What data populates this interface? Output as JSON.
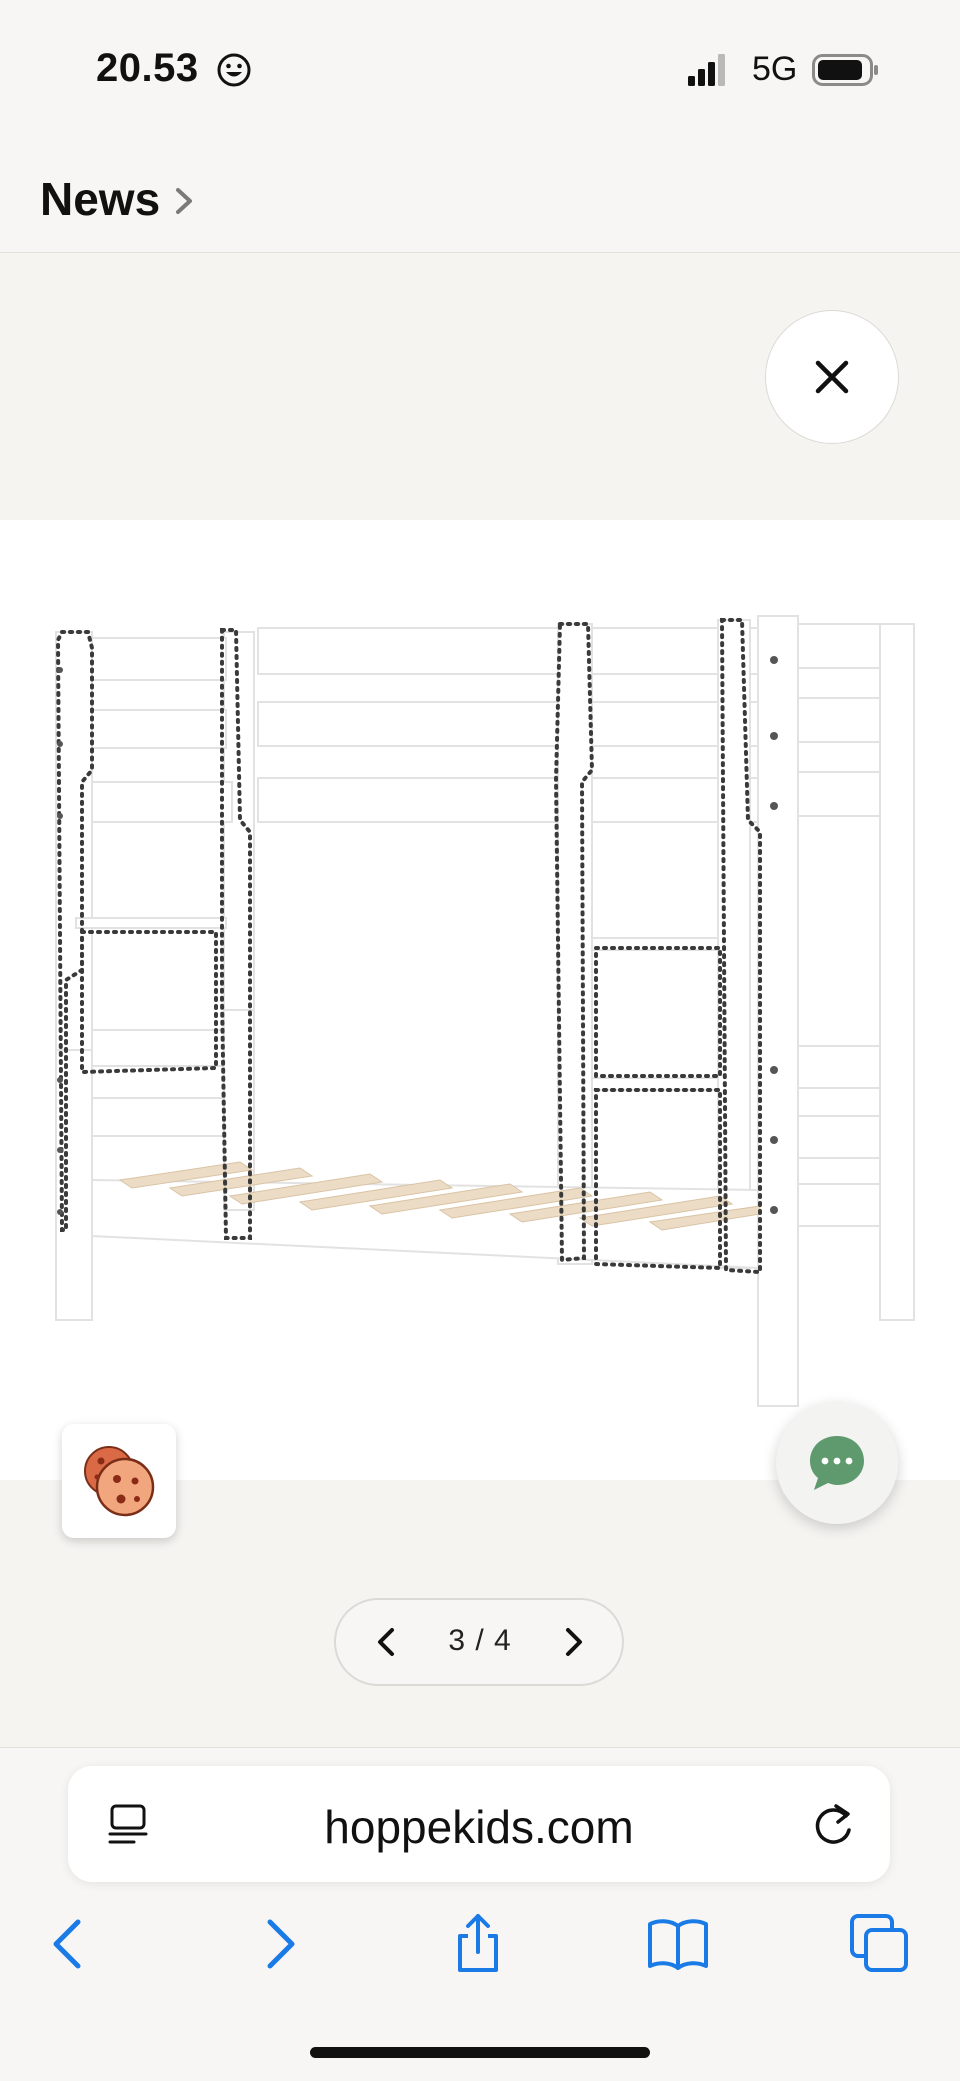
{
  "status_bar": {
    "time": "20.53",
    "network": "5G",
    "icons": [
      "smiley-icon",
      "signal-icon",
      "battery-icon"
    ]
  },
  "header": {
    "title": "News"
  },
  "gallery": {
    "pager_label": "3 / 4",
    "current": 3,
    "total": 4
  },
  "browser": {
    "url": "hoppekids.com",
    "toolbar": [
      "back-icon",
      "forward-icon",
      "share-icon",
      "bookmarks-icon",
      "tabs-icon"
    ]
  },
  "colors": {
    "accent": "#1a7ae6",
    "chat": "#5f9a6e",
    "background": "#f7f6f4",
    "cookie": "#e07a52"
  }
}
